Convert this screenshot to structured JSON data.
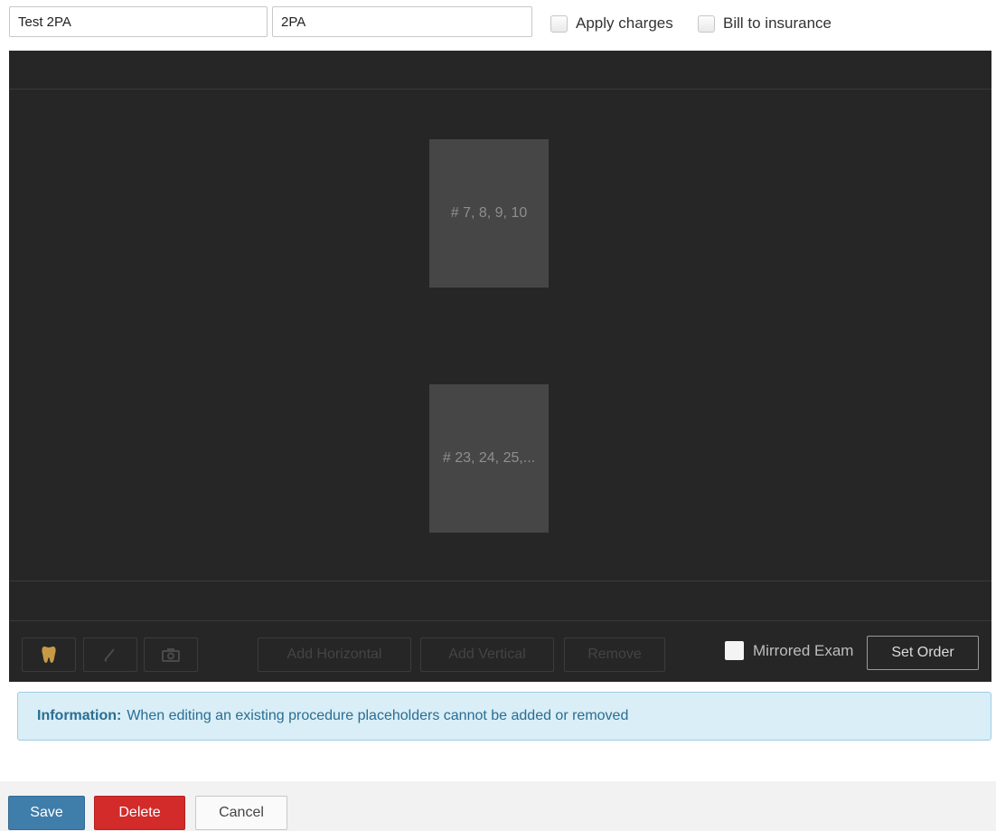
{
  "form": {
    "name_value": "Test 2PA",
    "code_value": "2PA",
    "apply_charges_label": "Apply charges",
    "bill_to_insurance_label": "Bill to insurance"
  },
  "editor": {
    "placeholders": [
      {
        "label": "# 7, 8, 9, 10"
      },
      {
        "label": "# 23, 24, 25,..."
      }
    ],
    "toolbar": {
      "icons": [
        "tooth-icon",
        "pen-icon",
        "camera-icon"
      ],
      "add_horizontal": "Add Horizontal",
      "add_vertical": "Add Vertical",
      "remove": "Remove",
      "mirrored_exam": "Mirrored Exam",
      "set_order": "Set Order"
    }
  },
  "info": {
    "title": "Information:",
    "message": "When editing an existing procedure placeholders cannot be added or removed"
  },
  "footer": {
    "save": "Save",
    "delete": "Delete",
    "cancel": "Cancel"
  },
  "colors": {
    "editor_bg": "#262626",
    "placeholder_bg": "#464646",
    "save": "#3f7dab",
    "delete": "#d32a2a",
    "info_bg": "#d9eef6"
  }
}
